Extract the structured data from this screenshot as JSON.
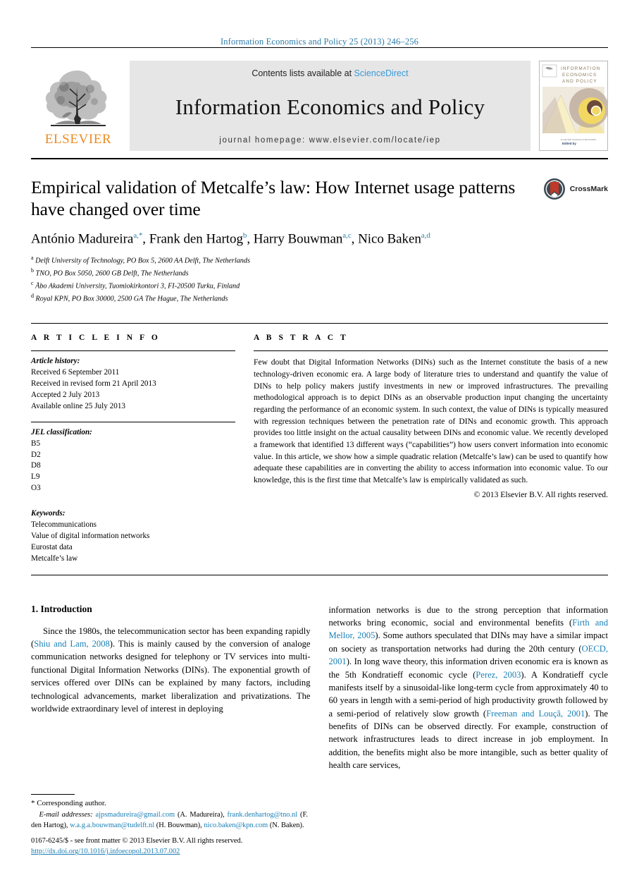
{
  "running_head": "Information Economics and Policy 25 (2013) 246–256",
  "masthead": {
    "contents_prefix": "Contents lists available at",
    "contents_link": "ScienceDirect",
    "journal_name": "Information Economics and Policy",
    "homepage": "journal homepage: www.elsevier.com/locate/iep",
    "publisher_wordmark": "ELSEVIER",
    "publisher_logo_name": "elsevier-tree-logo",
    "cover_title_lines": [
      "INFORMATION",
      "ECONOMICS",
      "AND POLICY"
    ],
    "cover_footer": "Edited by"
  },
  "crossmark": {
    "label": "CrossMark",
    "icon": "crossmark-logo"
  },
  "article": {
    "title": "Empirical validation of Metcalfe’s law: How Internet usage patterns have changed over time",
    "authors_html": "António Madureira <sup>a,*</sup>, Frank den Hartog <sup>b</sup>, Harry Bouwman <sup>a,c</sup>, Nico Baken <sup>a,d</sup>",
    "affiliations": [
      {
        "mark": "a",
        "text": "Delft University of Technology, PO Box 5, 2600 AA Delft, The Netherlands"
      },
      {
        "mark": "b",
        "text": "TNO, PO Box 5050, 2600 GB Delft, The Netherlands"
      },
      {
        "mark": "c",
        "text": "Åbo Akademi University, Tuomiokirkontori 3, FI-20500 Turku, Finland"
      },
      {
        "mark": "d",
        "text": "Royal KPN, PO Box 30000, 2500 GA The Hague, The Netherlands"
      }
    ]
  },
  "article_info": {
    "heading": "A R T I C L E   I N F O",
    "history_label": "Article history:",
    "history": [
      "Received 6 September 2011",
      "Received in revised form 21 April 2013",
      "Accepted 2 July 2013",
      "Available online 25 July 2013"
    ],
    "jel_label": "JEL classification:",
    "jel_codes": [
      "B5",
      "D2",
      "D8",
      "L9",
      "O3"
    ],
    "keywords_label": "Keywords:",
    "keywords": [
      "Telecommunications",
      "Value of digital information networks",
      "Eurostat data",
      "Metcalfe’s law"
    ]
  },
  "abstract": {
    "heading": "A B S T R A C T",
    "text": "Few doubt that Digital Information Networks (DINs) such as the Internet constitute the basis of a new technology-driven economic era. A large body of literature tries to understand and quantify the value of DINs to help policy makers justify investments in new or improved infrastructures. The prevailing methodological approach is to depict DINs as an observable production input changing the uncertainty regarding the performance of an economic system. In such context, the value of DINs is typically measured with regression techniques between the penetration rate of DINs and economic growth. This approach provides too little insight on the actual causality between DINs and economic value. We recently developed a framework that identified 13 different ways (“capabilities”) how users convert information into economic value. In this article, we show how a simple quadratic relation (Metcalfe’s law) can be used to quantify how adequate these capabilities are in converting the ability to access information into economic value. To our knowledge, this is the first time that Metcalfe’s law is empirically validated as such.",
    "copyright": "© 2013 Elsevier B.V. All rights reserved."
  },
  "body": {
    "section_heading": "1. Introduction",
    "left_paragraph_parts": [
      "Since the 1980s, the telecommunication sector has been expanding rapidly (",
      "Shiu and Lam, 2008",
      "). This is mainly caused by the conversion of analoge communication networks designed for telephony or TV services into multi-functional Digital Information Networks (DINs). The exponential growth of services offered over DINs can be explained by many factors, including technological advancements, market liberalization and privatizations. The worldwide extraordinary level of interest in deploying"
    ],
    "right_paragraph_parts": [
      "information networks is due to the strong perception that information networks bring economic, social and environmental benefits (",
      "Firth and Mellor, 2005",
      "). Some authors speculated that DINs may have a similar impact on society as transportation networks had during the 20th century (",
      "OECD, 2001",
      "). In long wave theory, this information driven economic era is known as the 5th Kondratieff economic cycle (",
      "Perez, 2003",
      "). A Kondratieff cycle manifests itself by a sinusoidal-like long-term cycle from approximately 40 to 60 years in length with a semi-period of high productivity growth followed by a semi-period of relatively slow growth (",
      "Freeman and Louçã, 2001",
      "). The benefits of DINs can be observed directly. For example, construction of network infrastructures leads to direct increase in job employment. In addition, the benefits might also be more intangible, such as better quality of health care services,"
    ]
  },
  "footnotes": {
    "corresponding_author": "* Corresponding author.",
    "email_label": "E-mail addresses:",
    "emails": [
      {
        "address": "ajpsmadureira@gmail.com",
        "owner": "(A. Madureira)"
      },
      {
        "address": "frank.denhartog@tno.nl",
        "owner": "(F. den Hartog)"
      },
      {
        "address": "w.a.g.a.bouwman@tudelft.nl",
        "owner": "(H. Bouwman)"
      },
      {
        "address": "nico.baken@kpn.com",
        "owner": "(N. Baken)"
      }
    ]
  },
  "imprint": {
    "issn_line": "0167-6245/$ - see front matter © 2013 Elsevier B.V. All rights reserved.",
    "doi": "http://dx.doi.org/10.1016/j.infoecopol.2013.07.002"
  },
  "colors": {
    "link_blue": "#1a7fb5",
    "running_head_blue": "#2e7ca8",
    "sciencedirect_blue": "#3a9ad9",
    "elsevier_orange": "#ec8b22",
    "band_gray": "#e6e6e6"
  }
}
